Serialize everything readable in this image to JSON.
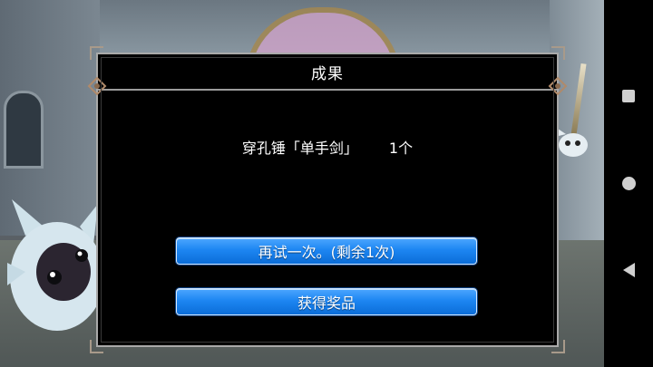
{
  "dialog": {
    "title": "成果",
    "result_item": "穿孔锤「单手剑」",
    "result_count": "1个",
    "retry_button_label": "再试一次。(剩余1次)",
    "claim_button_label": "获得奖品"
  },
  "nav": {
    "recents_icon": "square-icon",
    "home_icon": "circle-icon",
    "back_icon": "triangle-back-icon"
  },
  "colors": {
    "dialog_bg": "#000000",
    "button_blue": "#1d86f2",
    "frame_gray": "#a9a9a9"
  }
}
